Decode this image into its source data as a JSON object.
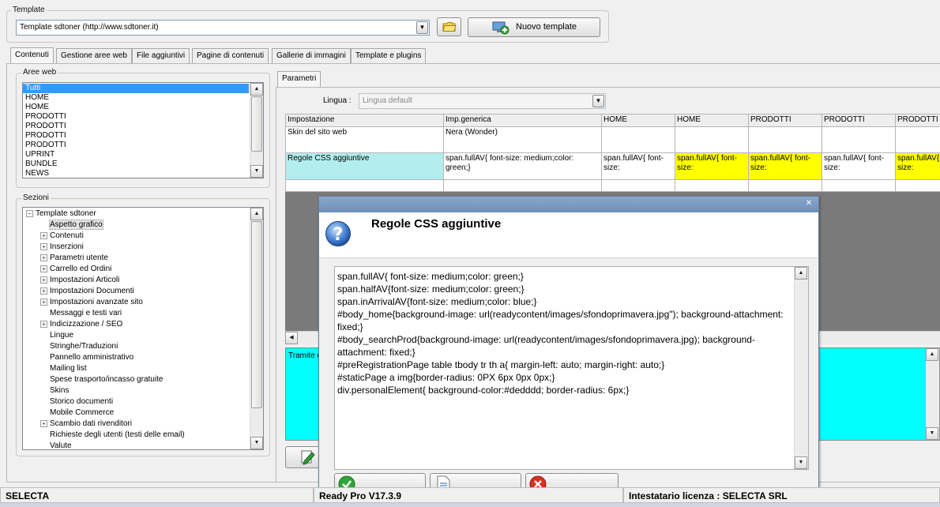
{
  "template_group": {
    "legend": "Template",
    "selected": "Template sdtoner (http://www.sdtoner.it)",
    "new_button": "Nuovo template"
  },
  "main_tabs": [
    {
      "label": "Contenuti"
    },
    {
      "label": "Gestione aree web"
    },
    {
      "label": "File aggiuntivi"
    },
    {
      "label": "Pagine di contenuti"
    },
    {
      "label": "Gallerie di immagini"
    },
    {
      "label": "Template e plugins"
    }
  ],
  "aree_web": {
    "legend": "Aree web",
    "items": [
      "Tutti",
      "HOME",
      "HOME",
      "PRODOTTI",
      "PRODOTTI",
      "PRODOTTI",
      "PRODOTTI",
      "UPRINT",
      "BUNDLE",
      "NEWS"
    ]
  },
  "sezioni": {
    "legend": "Sezioni",
    "root": "Template sdtoner",
    "items": [
      {
        "label": "Aspetto grafico",
        "expandable": false
      },
      {
        "label": "Contenuti",
        "expandable": true
      },
      {
        "label": "Inserzioni",
        "expandable": true
      },
      {
        "label": "Parametri utente",
        "expandable": true
      },
      {
        "label": "Carrello ed Ordini",
        "expandable": true
      },
      {
        "label": "Impostazioni Articoli",
        "expandable": true
      },
      {
        "label": "Impostazioni Documenti",
        "expandable": true
      },
      {
        "label": "Impostazioni avanzate sito",
        "expandable": true
      },
      {
        "label": "Messaggi e testi vari",
        "expandable": false
      },
      {
        "label": "Indicizzazione / SEO",
        "expandable": true
      },
      {
        "label": "Lingue",
        "expandable": false
      },
      {
        "label": "Stringhe/Traduzioni",
        "expandable": false
      },
      {
        "label": "Pannello amministrativo",
        "expandable": false
      },
      {
        "label": "Mailing list",
        "expandable": false
      },
      {
        "label": "Spese trasporto/incasso gratuite",
        "expandable": false
      },
      {
        "label": "Skins",
        "expandable": false
      },
      {
        "label": "Storico documenti",
        "expandable": false
      },
      {
        "label": "Mobile Commerce",
        "expandable": false
      },
      {
        "label": "Scambio dati rivenditori",
        "expandable": true
      },
      {
        "label": "Richieste degli utenti (testi delle email)",
        "expandable": false
      },
      {
        "label": "Valute",
        "expandable": false
      }
    ]
  },
  "parametri": {
    "tab": "Parametri",
    "lingua_label": "Lingua :",
    "lingua_value": "Lingua default",
    "columns": [
      "Impostazione",
      "Imp.generica",
      "HOME",
      "HOME",
      "PRODOTTI",
      "PRODOTTI",
      "PRODOTTI"
    ],
    "rows": [
      {
        "cells": [
          "Skin del sito web",
          "Nera (Wonder)",
          "",
          "",
          "",
          "",
          ""
        ]
      },
      {
        "cells": [
          "Regole CSS aggiuntive",
          "span.fullAV{ font-size: medium;color: green;}",
          "span.fullAV{ font-size:",
          "span.fullAV{ font-size:",
          "span.fullAV{ font-size:",
          "span.fullAV{ font-size:",
          "span.fullAV{ font-size:"
        ]
      }
    ],
    "description_prefix": "Tramite c"
  },
  "dialog": {
    "title": "Regole CSS aggiuntive",
    "close_glyph": "✕",
    "css_lines": [
      "span.fullAV{ font-size: medium;color: green;}",
      "span.halfAV{font-size: medium;color: green;}",
      "span.inArrivalAV{font-size: medium;color: blue;}",
      "#body_home{background-image: url(readycontent/images/sfondoprimavera.jpg\"); background-attachment: fixed;}",
      "#body_searchProd{background-image: url(readycontent/images/sfondoprimavera.jpg); background-attachment: fixed;}",
      "#preRegistrationPage table tbody tr th a{ margin-left: auto; margin-right: auto;}",
      "#staticPage a img{border-radius: 0PX 6px 0px 0px;}",
      "div.personalElement{ background-color:#dedddd; border-radius: 6px;}"
    ]
  },
  "status_bar": {
    "company": "SELECTA",
    "version": "Ready Pro V17.3.9",
    "license": "Intestatario licenza : SELECTA SRL"
  },
  "colors": {
    "cyan_cell": "#b2eeee",
    "yellow_cell": "#ffff00",
    "selection": "#3399ff",
    "description_bg": "#00ffff"
  }
}
